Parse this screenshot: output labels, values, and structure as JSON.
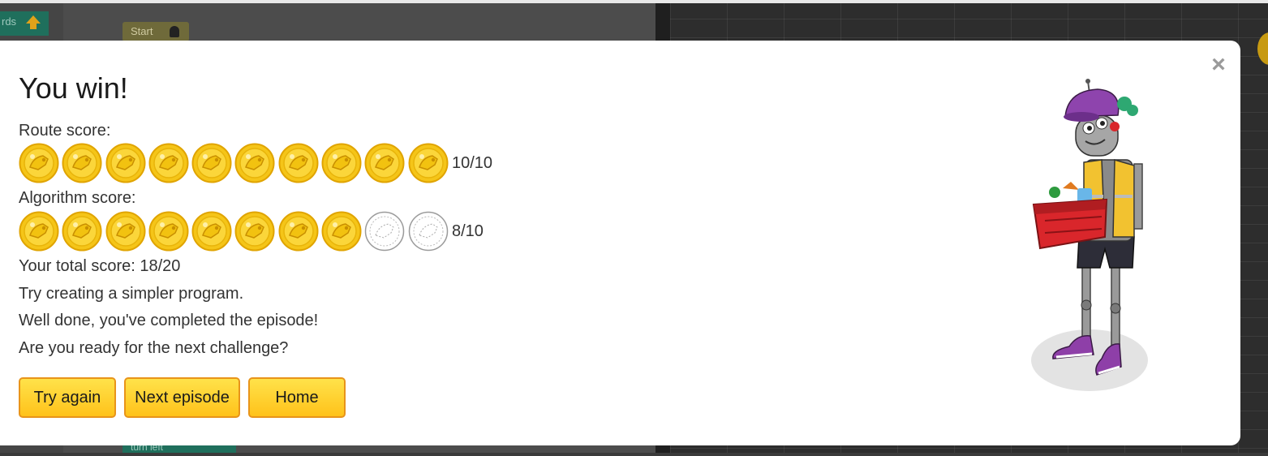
{
  "background": {
    "forwards_label": "rds",
    "start_label": "Start",
    "turn_label": "turn left"
  },
  "dialog": {
    "close_label": "×",
    "title": "You win!",
    "route_label": "Route score:",
    "route_score": "10/10",
    "route_coins": {
      "earned": 10,
      "total": 10
    },
    "algorithm_label": "Algorithm score:",
    "algorithm_score": "8/10",
    "algorithm_coins": {
      "earned": 8,
      "total": 10
    },
    "total_score": "Your total score: 18/20",
    "message_1": "Try creating a simpler program.",
    "message_2": "Well done, you've completed the episode!",
    "message_3": "Are you ready for the next challenge?",
    "buttons": {
      "try_again": "Try again",
      "next_episode": "Next episode",
      "home": "Home"
    }
  },
  "colors": {
    "coin_gold": "#f5c518",
    "button_fill": "#ffd22e",
    "button_border": "#e8941a",
    "robot_hat": "#8e44ad",
    "robot_vest": "#f2c230",
    "basket": "#d9262b"
  },
  "icons": [
    "close-icon",
    "gold-coin-icon",
    "empty-coin-icon",
    "robot-character"
  ]
}
